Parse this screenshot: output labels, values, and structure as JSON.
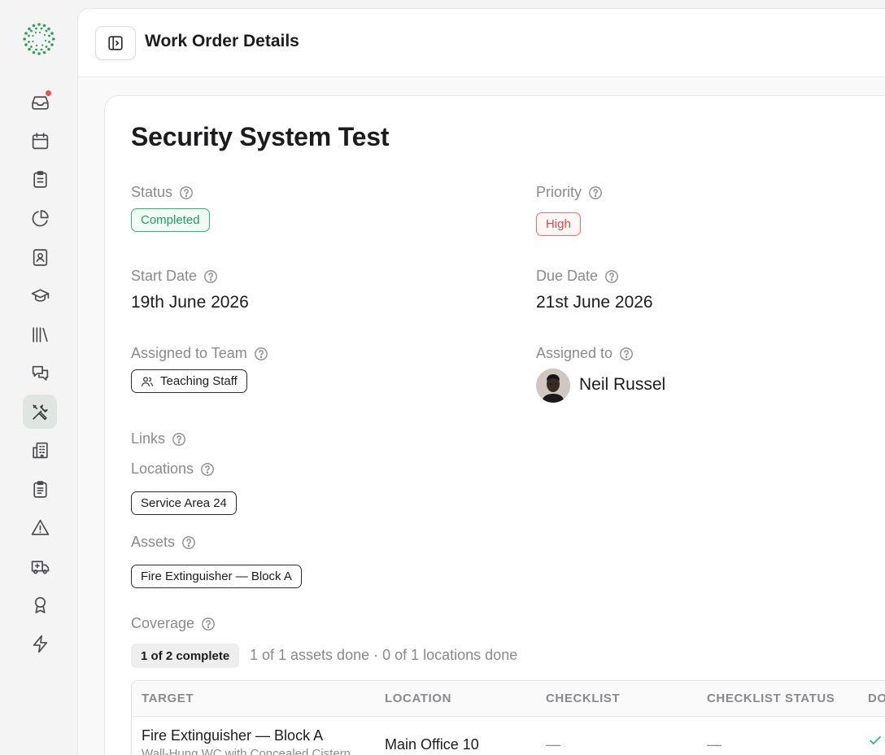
{
  "app": {
    "page_header_title": "Work Order Details"
  },
  "sidebar": {
    "items": [
      {
        "icon": "inbox-icon",
        "active": false,
        "notification": true
      },
      {
        "icon": "calendar-icon",
        "active": false
      },
      {
        "icon": "clipboard-icon",
        "active": false
      },
      {
        "icon": "pie-chart-icon",
        "active": false
      },
      {
        "icon": "contact-book-icon",
        "active": false
      },
      {
        "icon": "graduation-cap-icon",
        "active": false
      },
      {
        "icon": "library-icon",
        "active": false
      },
      {
        "icon": "chat-icon",
        "active": false
      },
      {
        "icon": "tools-icon",
        "active": true
      },
      {
        "icon": "building-icon",
        "active": false
      },
      {
        "icon": "clipboard-list-icon",
        "active": false
      },
      {
        "icon": "warning-icon",
        "active": false
      },
      {
        "icon": "ambulance-icon",
        "active": false
      },
      {
        "icon": "award-icon",
        "active": false
      },
      {
        "icon": "lightning-icon",
        "active": false
      }
    ]
  },
  "work_order": {
    "title": "Security System Test",
    "status": {
      "label": "Status",
      "value": "Completed"
    },
    "priority": {
      "label": "Priority",
      "value": "High"
    },
    "start_date": {
      "label": "Start Date",
      "value": "19th June 2026"
    },
    "due_date": {
      "label": "Due Date",
      "value": "21st June 2026"
    },
    "assigned_team": {
      "label": "Assigned to Team",
      "value": "Teaching Staff"
    },
    "assigned_to": {
      "label": "Assigned to",
      "value": "Neil Russel"
    },
    "links": {
      "label": "Links"
    },
    "locations": {
      "label": "Locations",
      "items": [
        "Service Area 24"
      ]
    },
    "assets": {
      "label": "Assets",
      "items": [
        "Fire Extinguisher — Block A"
      ]
    },
    "coverage": {
      "label": "Coverage",
      "badge": "1 of 2 complete",
      "summary": "1 of 1 assets done · 0 of 1 locations done"
    }
  },
  "coverage_table": {
    "columns": [
      "TARGET",
      "LOCATION",
      "CHECKLIST",
      "CHECKLIST STATUS",
      "DO"
    ],
    "rows": [
      {
        "target": "Fire Extinguisher — Block A",
        "target_sub": "Wall-Hung WC with Concealed Cistern",
        "location": "Main Office 10",
        "checklist": "—",
        "checklist_status": "—",
        "done": true
      }
    ]
  },
  "colors": {
    "status_completed": "#2eb67d",
    "priority_high": "#ef6a6a",
    "brand_green": "#2e9e5b",
    "notification": "#f04d4d"
  }
}
